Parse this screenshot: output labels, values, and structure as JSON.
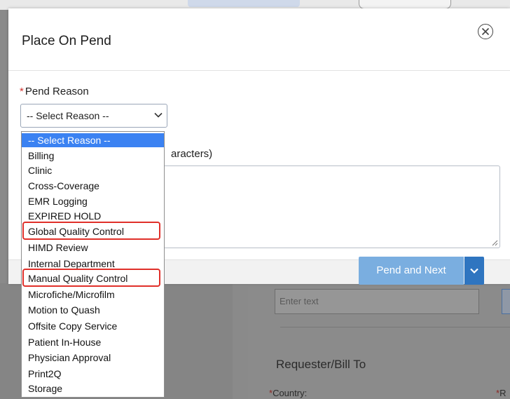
{
  "modal": {
    "title": "Place On Pend",
    "close_icon": "close-circle-icon"
  },
  "form": {
    "pend_reason": {
      "required_marker": "*",
      "label": "Pend Reason",
      "selected_value": "-- Select Reason --"
    },
    "notes": {
      "label_visible": "aracters)",
      "value": ""
    }
  },
  "footer": {
    "primary_button": "Pend and Next",
    "caret_icon": "chevron-down-icon"
  },
  "dropdown": {
    "options": [
      {
        "label": "-- Select Reason --",
        "selected": true
      },
      {
        "label": "Billing"
      },
      {
        "label": "Clinic"
      },
      {
        "label": "Cross-Coverage"
      },
      {
        "label": "EMR Logging"
      },
      {
        "label": "EXPIRED HOLD"
      },
      {
        "label": "Global Quality Control",
        "highlighted": true
      },
      {
        "label": "HIMD Review"
      },
      {
        "label": "Internal Department"
      },
      {
        "label": "Manual Quality Control",
        "highlighted": true
      },
      {
        "label": "Microfiche/Microfilm"
      },
      {
        "label": "Motion to Quash"
      },
      {
        "label": "Offsite Copy Service"
      },
      {
        "label": "Patient In-House"
      },
      {
        "label": "Physician Approval"
      },
      {
        "label": "Print2Q"
      },
      {
        "label": "Storage"
      }
    ]
  },
  "background_page": {
    "input_placeholder": "Enter text",
    "section_heading": "Requester/Bill To",
    "country_label": "Country:",
    "second_label_fragment": "R",
    "required_marker": "*"
  },
  "colors": {
    "primary_button": "#7aaee0",
    "caret_button": "#2f75c0",
    "selected_option": "#3b82f2",
    "highlight": "#e0302a",
    "required": "#d0312d"
  }
}
